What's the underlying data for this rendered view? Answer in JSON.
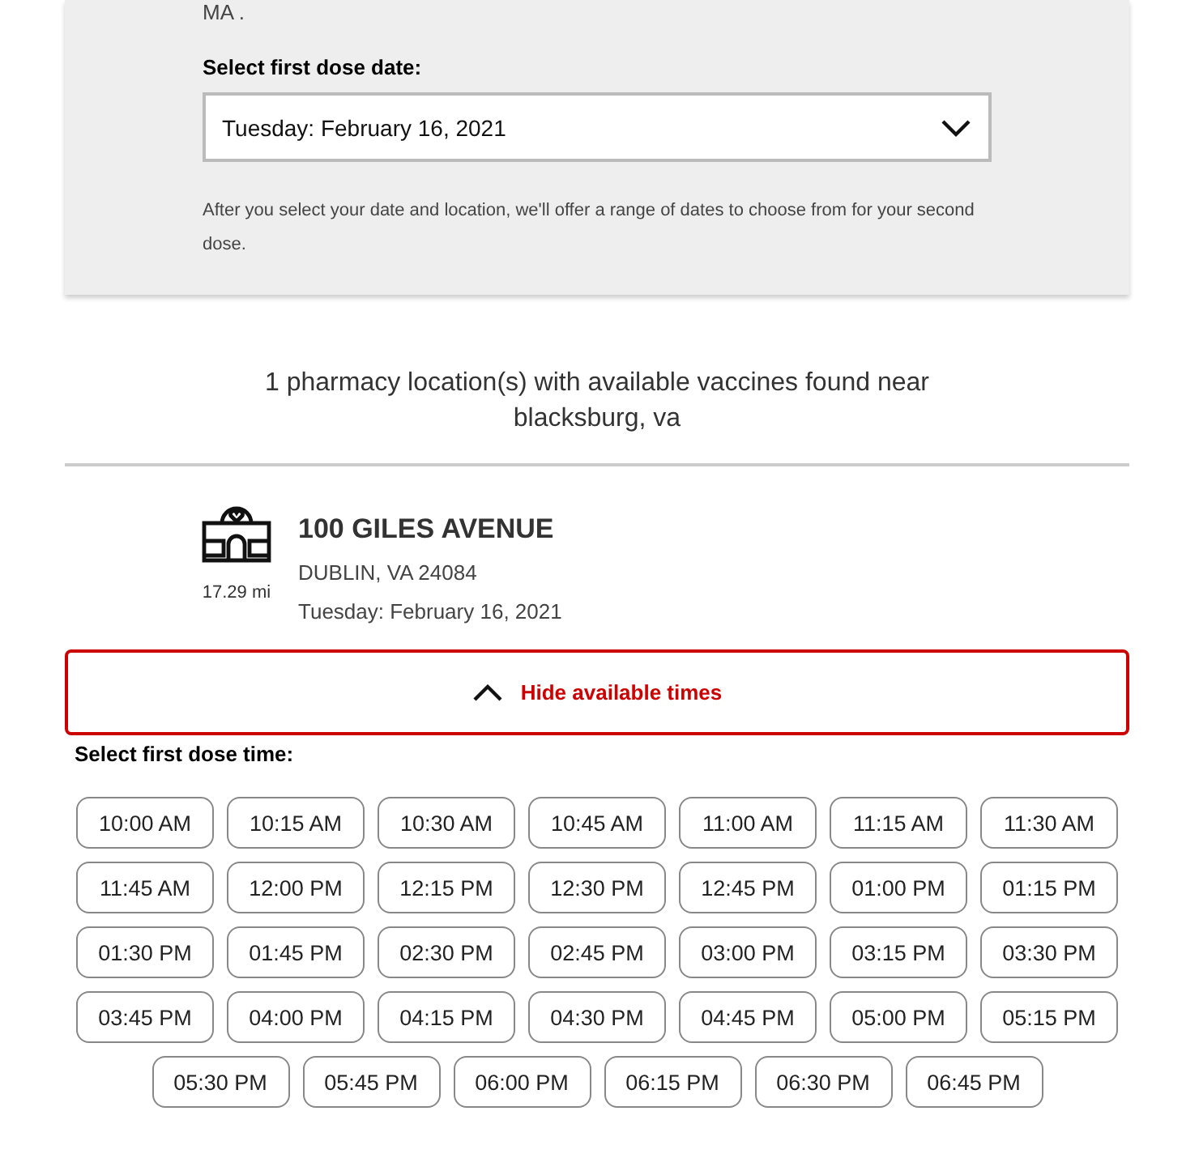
{
  "intro_tail": "MA .",
  "date_select": {
    "label": "Select first dose date:",
    "value": "Tuesday: February 16, 2021",
    "note": "After you select your date and location, we'll offer a range of dates to choose from for your second dose."
  },
  "results_summary": "1 pharmacy location(s) with available vaccines found near blacksburg, va",
  "location": {
    "name": "100 GILES AVENUE",
    "city": "DUBLIN, VA 24084",
    "date": "Tuesday: February 16, 2021",
    "distance": "17.29 mi"
  },
  "toggle": {
    "label": "Hide available times",
    "expanded": true
  },
  "time_label": "Select first dose time:",
  "times": [
    "10:00 AM",
    "10:15 AM",
    "10:30 AM",
    "10:45 AM",
    "11:00 AM",
    "11:15 AM",
    "11:30 AM",
    "11:45 AM",
    "12:00 PM",
    "12:15 PM",
    "12:30 PM",
    "12:45 PM",
    "01:00 PM",
    "01:15 PM",
    "01:30 PM",
    "01:45 PM",
    "02:30 PM",
    "02:45 PM",
    "03:00 PM",
    "03:15 PM",
    "03:30 PM",
    "03:45 PM",
    "04:00 PM",
    "04:15 PM",
    "04:30 PM",
    "04:45 PM",
    "05:00 PM",
    "05:15 PM",
    "05:30 PM",
    "05:45 PM",
    "06:00 PM",
    "06:15 PM",
    "06:30 PM",
    "06:45 PM"
  ]
}
